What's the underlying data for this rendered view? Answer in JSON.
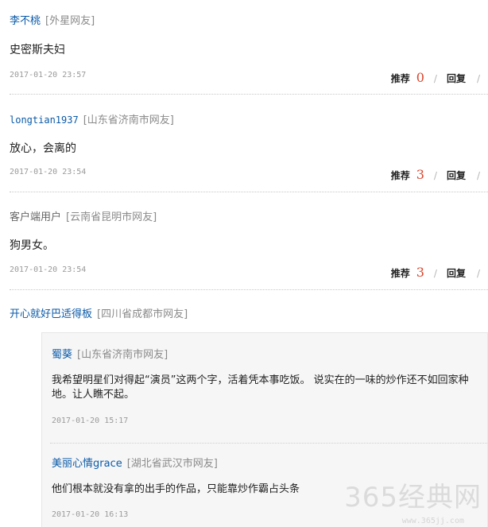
{
  "comments": [
    {
      "username": "李不桃",
      "location": "[外星网友]",
      "content": "史密斯夫妇",
      "time": "2017-01-20 23:57",
      "recommend_label": "推荐",
      "recommend_count": "0",
      "reply_label": "回复"
    },
    {
      "username": "longtian1937",
      "location": "[山东省济南市网友]",
      "content": "放心，会离的",
      "time": "2017-01-20 23:54",
      "recommend_label": "推荐",
      "recommend_count": "3",
      "reply_label": "回复"
    },
    {
      "username": "客户端用户",
      "location": "[云南省昆明市网友]",
      "content": "狗男女。",
      "time": "2017-01-20 23:54",
      "recommend_label": "推荐",
      "recommend_count": "3",
      "reply_label": "回复"
    },
    {
      "username": "开心就好巴适得板",
      "location": "[四川省成都市网友]"
    }
  ],
  "replies": [
    {
      "username": "蜀葵",
      "location": "[山东省济南市网友]",
      "content": "我希望明星们对得起“演员”这两个字，活着凭本事吃饭。 说实在的一味的炒作还不如回家种地。让人瞧不起。",
      "time": "2017-01-20 15:17"
    },
    {
      "username": "美丽心情grace",
      "location": "[湖北省武汉市网友]",
      "content": "他们根本就没有拿的出手的作品，只能靠炒作霸占头条",
      "time": "2017-01-20 16:13"
    }
  ],
  "separator": "/",
  "watermark": {
    "text": "365经典网",
    "sub": "www.365jj.com"
  },
  "colors": {
    "username": "#0a5aa8",
    "count": "#d9462f",
    "location": "#8a8a8a"
  }
}
